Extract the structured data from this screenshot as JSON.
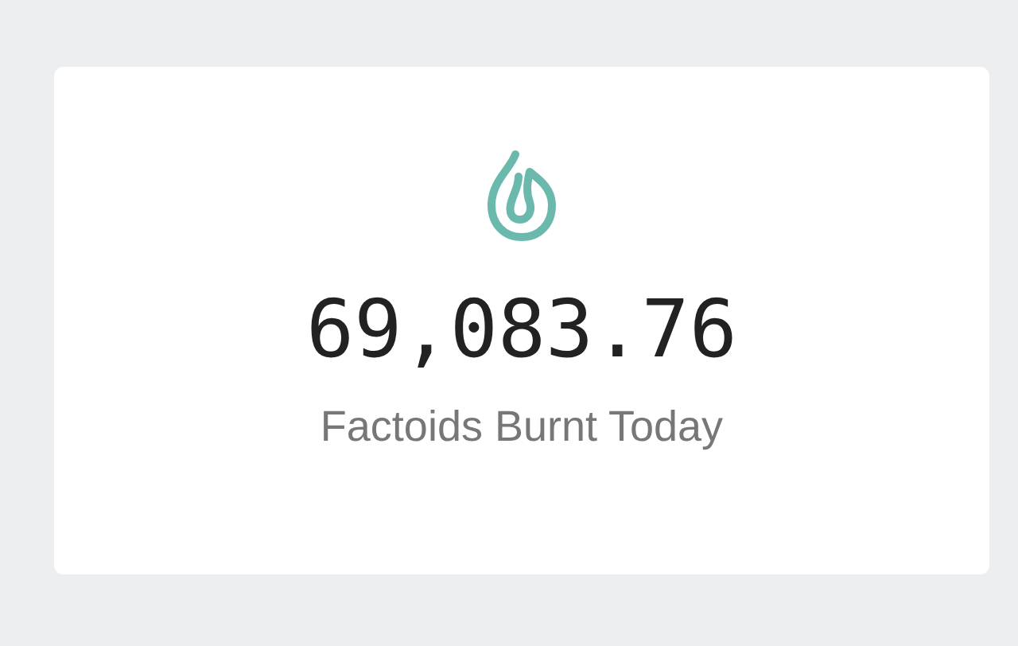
{
  "stat": {
    "value": "69,083.76",
    "label": "Factoids Burnt Today"
  }
}
